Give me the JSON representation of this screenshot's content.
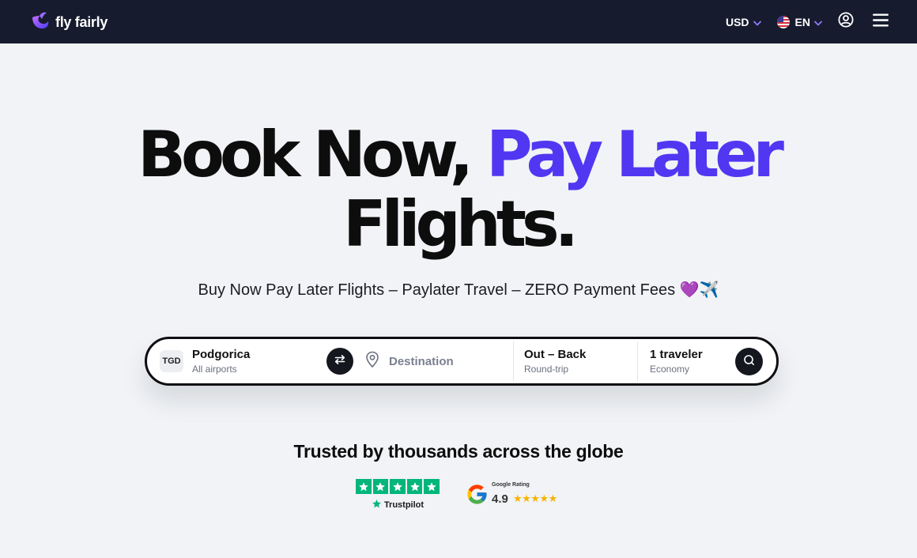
{
  "header": {
    "logo_text": "fly fairly",
    "currency": "USD",
    "language": "EN",
    "icons": {
      "account": "account-icon",
      "menu": "hamburger-menu-icon",
      "flag": "us-flag-icon"
    }
  },
  "hero": {
    "title_part1": "Book Now,",
    "title_accent": "Pay Later",
    "title_part2": "Flights.",
    "subtitle": "Buy Now Pay Later Flights – Paylater Travel – ZERO Payment Fees 💜✈️"
  },
  "search": {
    "origin_code": "TGD",
    "origin_city": "Podgorica",
    "origin_sub": "All airports",
    "destination_placeholder": "Destination",
    "dates_main": "Out – Back",
    "dates_sub": "Round-trip",
    "travelers_main": "1 traveler",
    "travelers_sub": "Economy"
  },
  "trust": {
    "heading": "Trusted by thousands across the globe",
    "trustpilot_label": "Trustpilot",
    "trustpilot_stars": 5,
    "google_caption": "Google Rating",
    "google_score": "4.9",
    "google_stars": 5
  },
  "colors": {
    "nav_bg": "#161b2e",
    "accent": "#5137f2",
    "page_bg": "#f1f3f6",
    "trustpilot_green": "#00b67a",
    "star_gold": "#f5b400"
  }
}
